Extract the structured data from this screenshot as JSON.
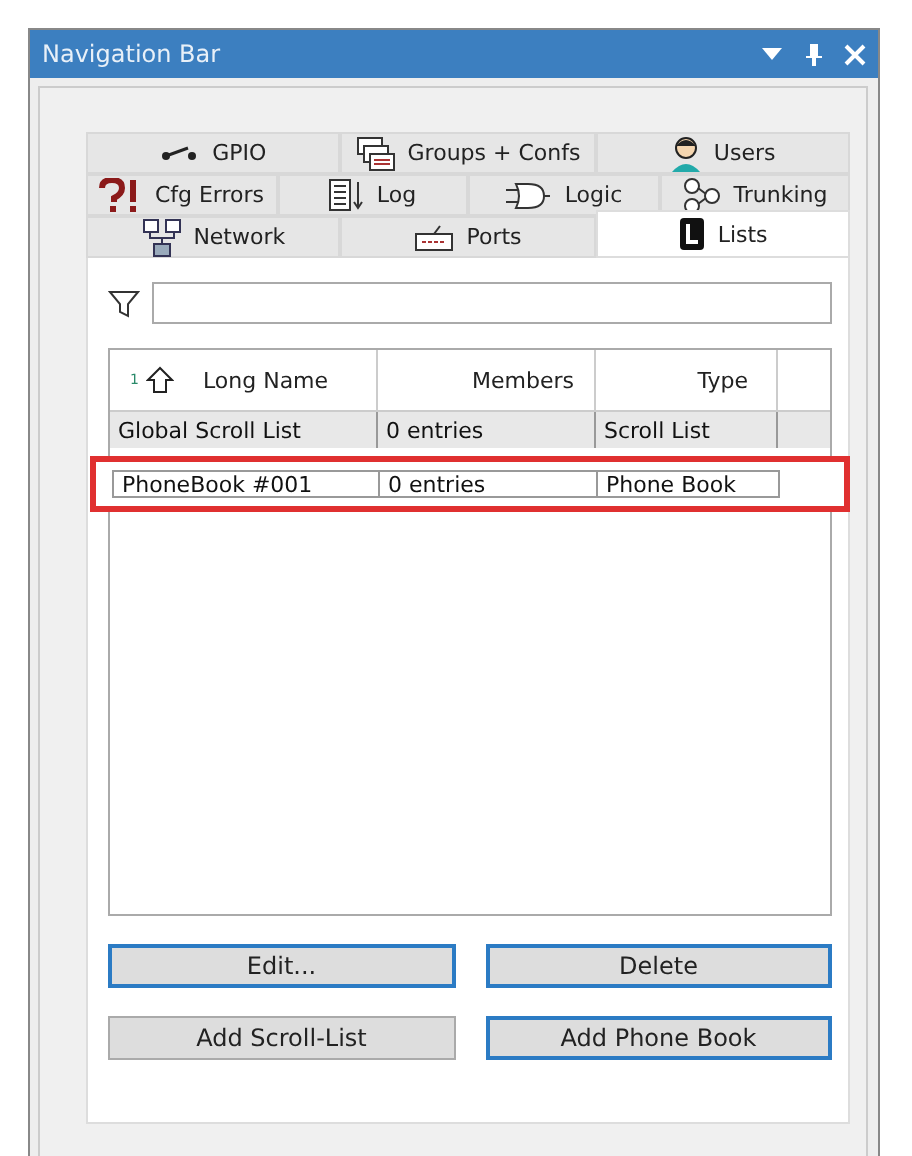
{
  "window": {
    "title": "Navigation Bar"
  },
  "tab_rows": [
    [
      {
        "label": "GPIO",
        "selected": false
      },
      {
        "label": "Groups + Confs",
        "selected": false
      },
      {
        "label": "Users",
        "selected": false
      }
    ],
    [
      {
        "label": "Cfg Errors",
        "selected": false
      },
      {
        "label": "Log",
        "selected": false
      },
      {
        "label": "Logic",
        "selected": false
      },
      {
        "label": "Trunking",
        "selected": false
      }
    ],
    [
      {
        "label": "Network",
        "selected": false
      },
      {
        "label": "Ports",
        "selected": false
      },
      {
        "label": "Lists",
        "selected": true
      }
    ]
  ],
  "table": {
    "sort_marker": "1",
    "columns": [
      "Long Name",
      "Members",
      "Type"
    ],
    "rows": [
      {
        "cells": [
          "Global Scroll List",
          "0 entries",
          "Scroll List"
        ],
        "selected": false
      },
      {
        "cells": [
          "PhoneBook #001",
          "0 entries",
          "Phone Book"
        ],
        "selected": true
      }
    ]
  },
  "buttons": [
    {
      "label": "Edit...",
      "highlighted": true
    },
    {
      "label": "Delete",
      "highlighted": true
    },
    {
      "label": "Add Scroll-List",
      "highlighted": false
    },
    {
      "label": "Add Phone Book",
      "highlighted": true
    }
  ]
}
